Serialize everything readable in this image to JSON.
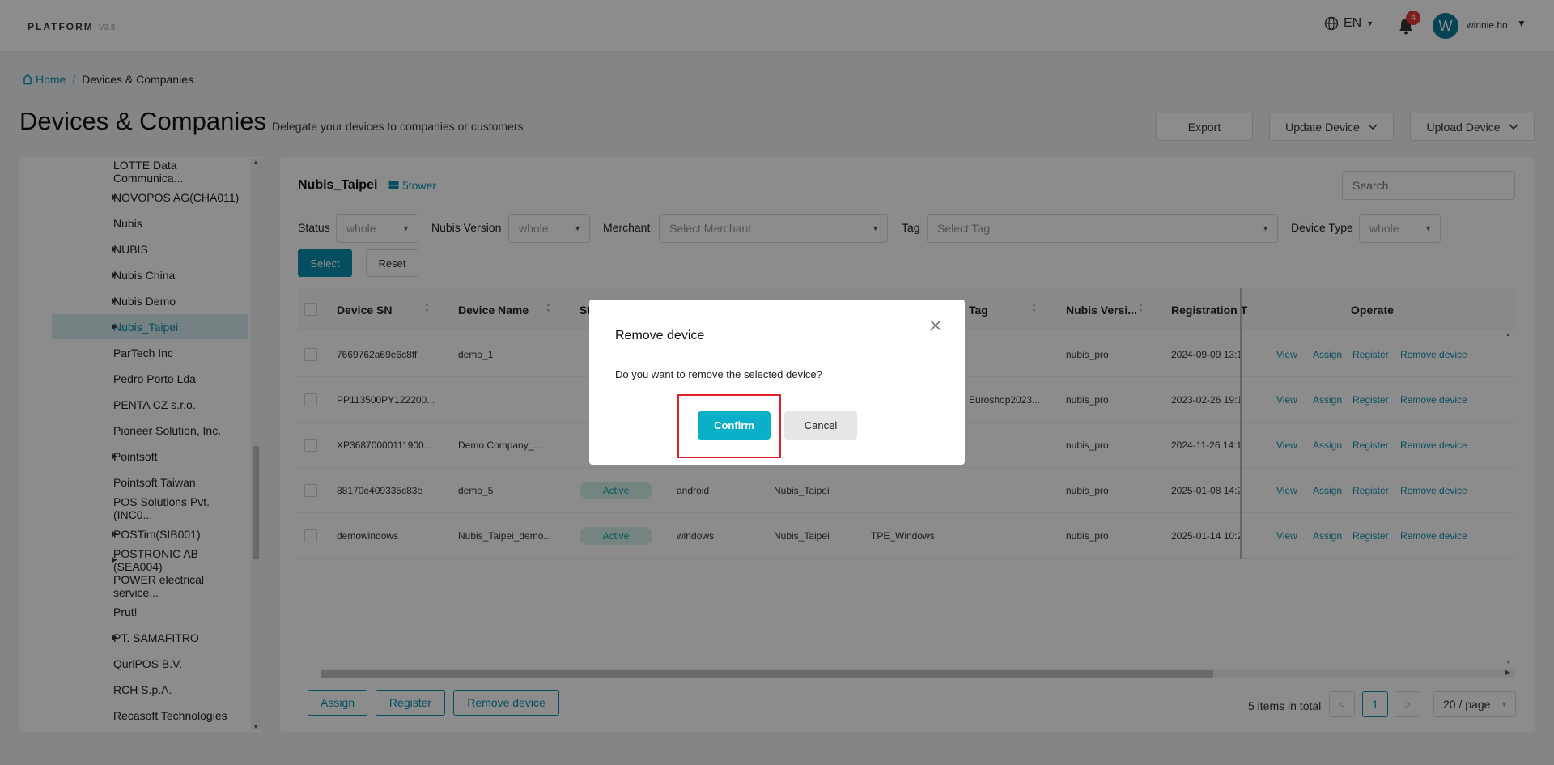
{
  "header": {
    "brand": "PLATFORM",
    "version": "V3.8",
    "language": "EN",
    "notification_count": "4",
    "avatar_letter": "W",
    "username": "winnie.ho"
  },
  "breadcrumb": {
    "home": "Home",
    "current": "Devices & Companies"
  },
  "page": {
    "title": "Devices & Companies",
    "subtitle": "Delegate your devices to companies or customers",
    "export_label": "Export",
    "update_device_label": "Update Device",
    "upload_device_label": "Upload Device"
  },
  "tree": {
    "items": [
      {
        "label": "LOTTE Data Communica...",
        "has_children": false,
        "selected": false
      },
      {
        "label": "NOVOPOS AG(CHA011)",
        "has_children": true,
        "selected": false
      },
      {
        "label": "Nubis",
        "has_children": false,
        "selected": false
      },
      {
        "label": "NUBIS",
        "has_children": true,
        "selected": false
      },
      {
        "label": "Nubis China",
        "has_children": true,
        "selected": false
      },
      {
        "label": "Nubis Demo",
        "has_children": true,
        "selected": false
      },
      {
        "label": "Nubis_Taipei",
        "has_children": true,
        "selected": true
      },
      {
        "label": "ParTech Inc",
        "has_children": false,
        "selected": false
      },
      {
        "label": "Pedro Porto Lda",
        "has_children": false,
        "selected": false
      },
      {
        "label": "PENTA CZ s.r.o.",
        "has_children": false,
        "selected": false
      },
      {
        "label": "Pioneer Solution, Inc.",
        "has_children": false,
        "selected": false
      },
      {
        "label": "Pointsoft",
        "has_children": true,
        "selected": false
      },
      {
        "label": "Pointsoft Taiwan",
        "has_children": false,
        "selected": false
      },
      {
        "label": "POS Solutions Pvt.(INC0...",
        "has_children": false,
        "selected": false
      },
      {
        "label": "POSTim(SIB001)",
        "has_children": true,
        "selected": false
      },
      {
        "label": "POSTRONIC AB (SEA004)",
        "has_children": true,
        "selected": false
      },
      {
        "label": "POWER electrical service...",
        "has_children": false,
        "selected": false
      },
      {
        "label": "Prut!",
        "has_children": false,
        "selected": false
      },
      {
        "label": "PT. SAMAFITRO",
        "has_children": true,
        "selected": false
      },
      {
        "label": "QuriPOS B.V.",
        "has_children": false,
        "selected": false
      },
      {
        "label": "RCH S.p.A.",
        "has_children": false,
        "selected": false
      },
      {
        "label": "Recasoft Technologies",
        "has_children": false,
        "selected": false
      }
    ]
  },
  "card": {
    "title": "Nubis_Taipei",
    "tower": "5tower",
    "search_placeholder": "Search"
  },
  "filters": {
    "status_label": "Status",
    "status_value": "whole",
    "version_label": "Nubis Version",
    "version_value": "whole",
    "merchant_label": "Merchant",
    "merchant_placeholder": "Select Merchant",
    "tag_label": "Tag",
    "tag_placeholder": "Select Tag",
    "device_type_label": "Device Type",
    "device_type_value": "whole",
    "select_label": "Select",
    "reset_label": "Reset"
  },
  "table": {
    "columns": {
      "sn": "Device SN",
      "name": "Device Name",
      "status": "St",
      "tag": "Tag",
      "version": "Nubis Versi...",
      "registration": "Registration T",
      "operate": "Operate"
    },
    "rows": [
      {
        "sn": "7669762a69e6c8ff",
        "name": "demo_1",
        "status": "",
        "os": "",
        "company": "",
        "site": "",
        "tag": "",
        "version": "nubis_pro",
        "registration": "2024-09-09 13:1"
      },
      {
        "sn": "PP113500PY122200...",
        "name": "",
        "status": "",
        "os": "",
        "company": "",
        "site": "",
        "tag": "Euroshop2023...",
        "version": "nubis_pro",
        "registration": "2023-02-26 19:1"
      },
      {
        "sn": "XP36870000111900...",
        "name": "Demo Company_...",
        "status": "",
        "os": "",
        "company": "",
        "site": "",
        "tag": "",
        "version": "nubis_pro",
        "registration": "2024-11-26 14:1"
      },
      {
        "sn": "88170e409335c83e",
        "name": "demo_5",
        "status": "Active",
        "os": "android",
        "company": "Nubis_Taipei",
        "site": "",
        "tag": "",
        "version": "nubis_pro",
        "registration": "2025-01-08 14:2"
      },
      {
        "sn": "demowindows",
        "name": "Nubis_Taipei_demo...",
        "status": "Active",
        "os": "windows",
        "company": "Nubis_Taipei",
        "site": "TPE_Windows",
        "tag": "",
        "version": "nubis_pro",
        "registration": "2025-01-14 10:2"
      }
    ],
    "ops": {
      "view": "View",
      "assign": "Assign",
      "register": "Register",
      "remove": "Remove device"
    }
  },
  "footer": {
    "assign_label": "Assign",
    "register_label": "Register",
    "remove_label": "Remove device",
    "total_text": "5 items in total",
    "prev": "<",
    "current_page": "1",
    "next": ">",
    "page_size": "20 / page"
  },
  "modal": {
    "title": "Remove device",
    "message": "Do you want to remove the selected device?",
    "confirm_label": "Confirm",
    "cancel_label": "Cancel"
  },
  "colors": {
    "accent": "#0a8fb0",
    "confirm": "#0ab0c8",
    "highlight": "#e0202b"
  }
}
